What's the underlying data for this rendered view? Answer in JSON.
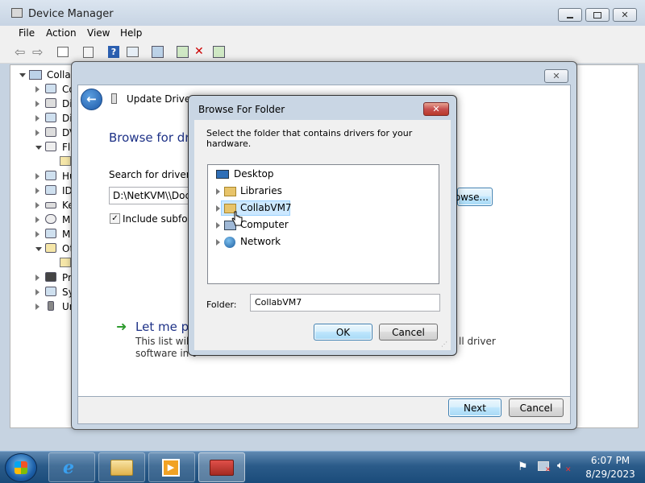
{
  "device_manager": {
    "title": "Device Manager",
    "menu": [
      "File",
      "Action",
      "View",
      "Help"
    ],
    "tree_root": "Collab",
    "tree_items": [
      "Co",
      "Di",
      "Di",
      "DV",
      "Flo",
      "Hu",
      "ID",
      "Ke",
      "Mi",
      "Mo",
      "Ot",
      "Pr",
      "Sy",
      "Ur"
    ]
  },
  "update_driver": {
    "title": "Update Driver So",
    "heading": "Browse for dri",
    "search_label": "Search for driver so",
    "path_value": "D:\\NetKVM\\\\Docu",
    "browse_button": "owse...",
    "include_subfolders": "Include subfold",
    "let_me_pick": "Let me pic",
    "list_desc_1": "This list will s",
    "list_desc_1_end": "ll driver",
    "list_desc_2": "software in t",
    "next_button": "Next",
    "cancel_button": "Cancel"
  },
  "browse_folder": {
    "title": "Browse For Folder",
    "instruction": "Select the folder that contains drivers for your hardware.",
    "tree": [
      {
        "label": "Desktop",
        "icon": "desktop-icon"
      },
      {
        "label": "Libraries",
        "icon": "libraries-icon"
      },
      {
        "label": "CollabVM7",
        "icon": "user-folder-icon",
        "selected": true
      },
      {
        "label": "Computer",
        "icon": "computer-icon"
      },
      {
        "label": "Network",
        "icon": "network-icon"
      }
    ],
    "folder_label": "Folder:",
    "folder_value": "CollabVM7",
    "ok_button": "OK",
    "cancel_button": "Cancel"
  },
  "taskbar": {
    "time": "6:07 PM",
    "date": "8/29/2023",
    "pinned": [
      "internet-explorer-icon",
      "explorer-icon",
      "media-player-icon",
      "device-manager-icon"
    ]
  },
  "colors": {
    "taskbar": "#1a4b7a",
    "dialog_frame": "#c9d6e4",
    "close_red": "#c75050",
    "selection": "#cce8ff",
    "link_blue": "#1e3287"
  }
}
